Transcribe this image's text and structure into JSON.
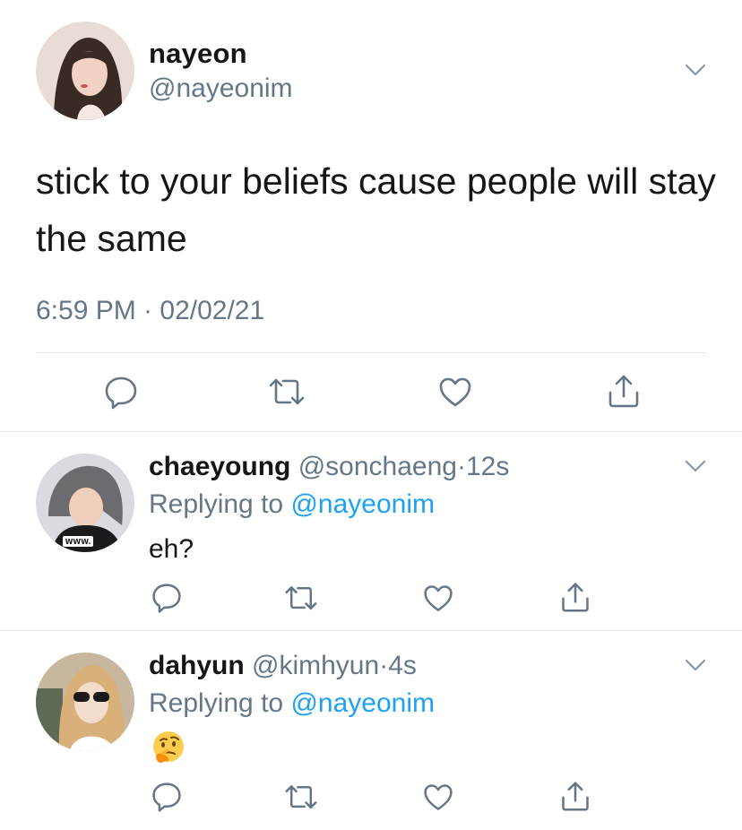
{
  "main_tweet": {
    "display_name": "nayeon",
    "handle": "@nayeonim",
    "text": "stick to your beliefs cause people will stay the same",
    "timestamp": "6:59 PM · 02/02/21",
    "avatar_icon": "user-photo-avatar"
  },
  "replies": [
    {
      "display_name": "chaeyoung",
      "handle": "@sonchaeng",
      "separator": "·",
      "time_ago": "12s",
      "replying_prefix": "Replying to ",
      "replying_to": "@nayeonim",
      "text": "eh?",
      "avatar_icon": "user-photo-avatar"
    },
    {
      "display_name": "dahyun",
      "handle": "@kimhyun",
      "separator": "·",
      "time_ago": "4s",
      "replying_prefix": "Replying to ",
      "replying_to": "@nayeonim",
      "text": "🤔",
      "avatar_icon": "user-photo-avatar"
    }
  ],
  "actions": [
    "reply-icon",
    "retweet-icon",
    "like-icon",
    "share-icon"
  ],
  "colors": {
    "text": "#14171a",
    "secondary": "#657786",
    "link": "#1da1f2",
    "divider": "#e1e8ed",
    "icon": "#657786"
  }
}
